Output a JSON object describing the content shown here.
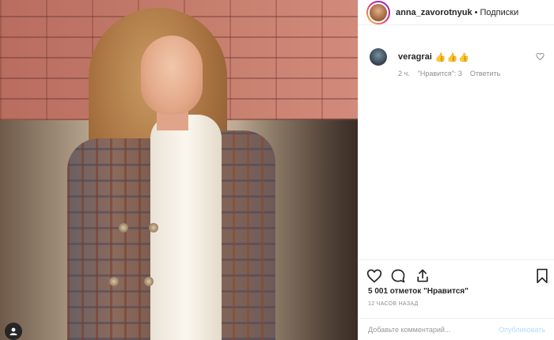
{
  "post": {
    "username": "anna_zavorotnyuk",
    "separator": "•",
    "follow_label": "Подписки"
  },
  "comment": {
    "username": "veragrai",
    "text": "👍👍👍",
    "age": "2 ч.",
    "likes_label": "\"Нравится\": 3",
    "reply_label": "Ответить"
  },
  "stats": {
    "likes": "5 001 отметок \"Нравится\"",
    "time_ago": "12 ЧАСОВ НАЗАД"
  },
  "composer": {
    "placeholder": "Добавьте комментарий...",
    "publish_label": "Опубликовать"
  },
  "icons": {
    "like": "heart-icon",
    "comment": "comment-icon",
    "share": "share-icon",
    "save": "bookmark-icon",
    "comment_like": "heart-small-icon",
    "photo_tag": "user-tag-icon"
  },
  "colors": {
    "text": "#262626",
    "muted": "#8e8e8e",
    "border": "#efefef",
    "publish_disabled": "#b3dbff"
  }
}
